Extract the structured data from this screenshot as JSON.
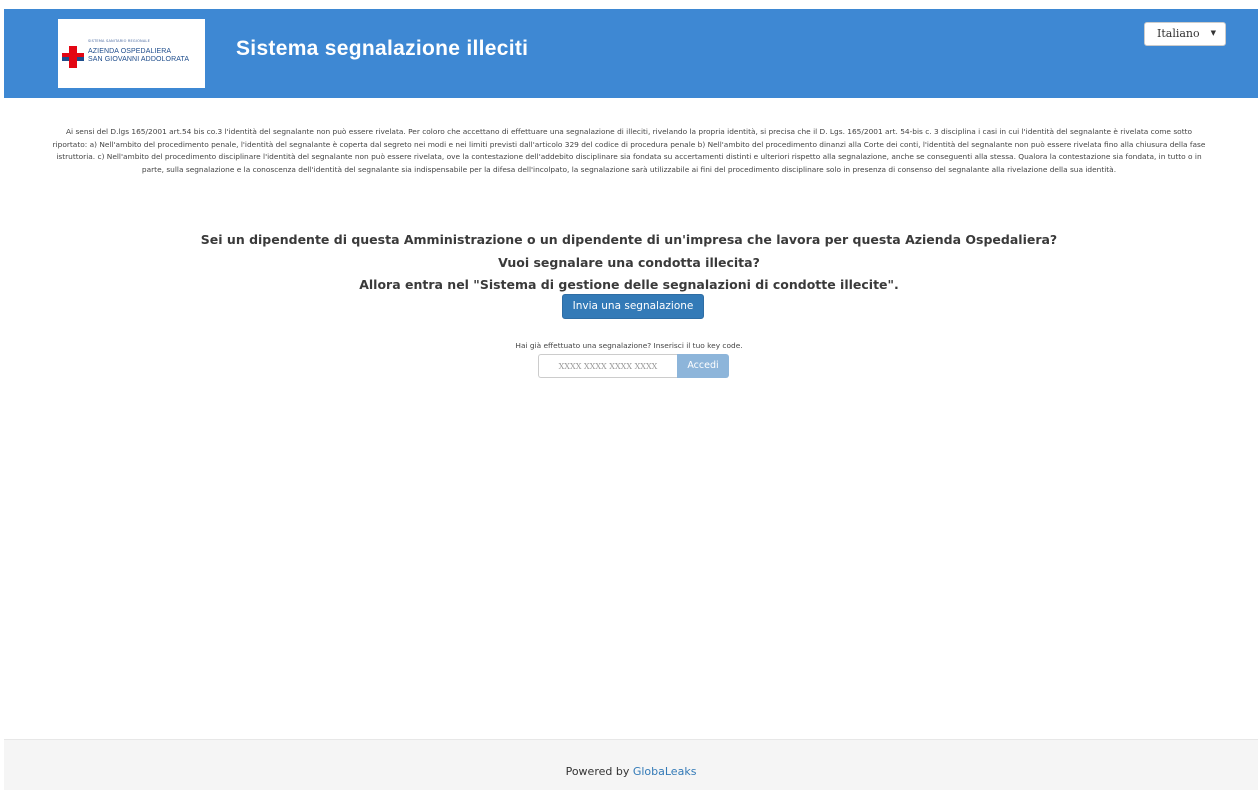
{
  "header": {
    "logo": {
      "region_text": "SISTEMA SANITARIO REGIONALE",
      "line1": "AZIENDA OSPEDALIERA",
      "line2": "SAN GIOVANNI ADDOLORATA"
    },
    "title": "Sistema segnalazione illeciti",
    "language": "Italiano"
  },
  "disclaimer": "Ai sensi del D.lgs 165/2001 art.54 bis co.3 l'identità del segnalante non può essere rivelata. Per coloro che accettano di effettuare una segnalazione di illeciti, rivelando la propria identità, si precisa che il D. Lgs. 165/2001 art. 54-bis c. 3 disciplina i casi in cui l'identità del segnalante è rivelata come sotto riportato: a) Nell'ambito del procedimento penale, l'identità del segnalante è coperta dal segreto nei modi e nei limiti previsti dall'articolo 329 del codice di procedura penale b) Nell'ambito del procedimento dinanzi alla Corte dei conti, l'identità del segnalante non può essere rivelata fino alla chiusura della fase istruttoria. c) Nell'ambito del procedimento disciplinare l'identità del segnalante non può essere rivelata, ove la contestazione dell'addebito disciplinare sia fondata su accertamenti distinti e ulteriori rispetto alla segnalazione, anche se conseguenti alla stessa. Qualora la contestazione sia fondata, in tutto o in parte, sulla segnalazione e la conoscenza dell'identità del segnalante sia indispensabile per la difesa dell'incolpato, la segnalazione sarà utilizzabile ai fini del procedimento disciplinare solo in presenza di consenso del segnalante alla rivelazione della sua identità.",
  "main": {
    "question1": "Sei un dipendente di questa Amministrazione o un dipendente di un'impresa che lavora per questa Azienda Ospedaliera?",
    "question2": "Vuoi segnalare una condotta illecita?",
    "question3": "Allora entra nel \"Sistema di gestione delle segnalazioni di condotte illecite\".",
    "send_button": "Invia una segnalazione",
    "key_prompt": "Hai già effettuato una segnalazione? Inserisci il tuo key code.",
    "key_placeholder": "XXXX XXXX XXXX XXXX",
    "login_button": "Accedi"
  },
  "footer": {
    "powered_by": "Powered by",
    "link_text": "GlobaLeaks"
  },
  "colors": {
    "header_bg": "#3e88d3",
    "primary_button": "#337ab7",
    "disabled_button": "#8db5da",
    "logo_red": "#e30613",
    "logo_blue": "#1e4d8c"
  }
}
